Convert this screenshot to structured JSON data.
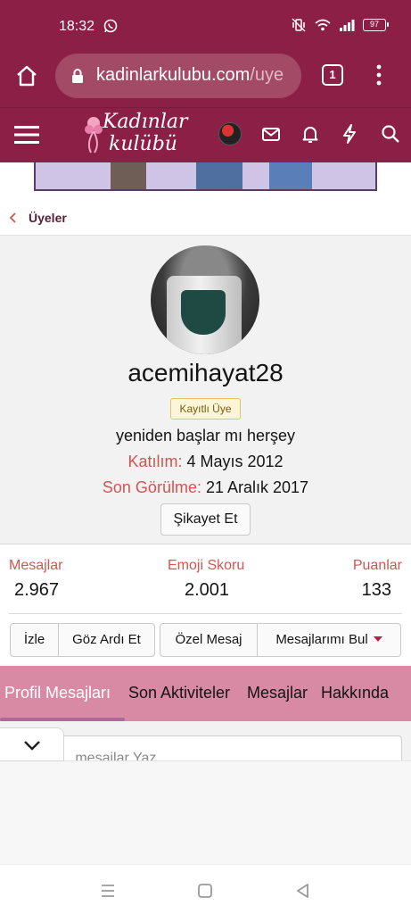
{
  "status_bar": {
    "time": "18:32",
    "battery": "97"
  },
  "browser": {
    "url_main": "kadinlarkulubu.com",
    "url_rest": "/uye",
    "tab_count": "1"
  },
  "site": {
    "logo_line1": "Kadınlar",
    "logo_line2": "kulübü"
  },
  "breadcrumb": {
    "label": "Üyeler"
  },
  "profile": {
    "username": "acemihayat28",
    "role": "Kayıtlı Üye",
    "custom_title": "yeniden başlar mı herşey",
    "joined_label": "Katılım:",
    "joined_value": "4 Mayıs 2012",
    "last_seen_label": "Son Görülme:",
    "last_seen_value": "21 Aralık 2017",
    "report_label": "Şikayet Et"
  },
  "stats": [
    {
      "label": "Mesajlar",
      "value": "2.967"
    },
    {
      "label": "Emoji Skoru",
      "value": "2.001"
    },
    {
      "label": "Puanlar",
      "value": "133"
    }
  ],
  "actions": {
    "follow": "İzle",
    "ignore": "Göz Ardı Et",
    "private_message": "Özel Mesaj",
    "find_messages": "Mesajlarımı Bul"
  },
  "tabs": [
    {
      "label": "Profil Mesajları",
      "active": true
    },
    {
      "label": "Son Aktiviteler",
      "active": false
    },
    {
      "label": "Mesajlar",
      "active": false
    },
    {
      "label": "Hakkında",
      "active": false
    }
  ],
  "post_box": {
    "placeholder": "...mesajlar Yaz..."
  },
  "colors": {
    "brand": "#8c1f45",
    "accent_red": "#d25550",
    "tab_bg": "#d88aa4"
  }
}
